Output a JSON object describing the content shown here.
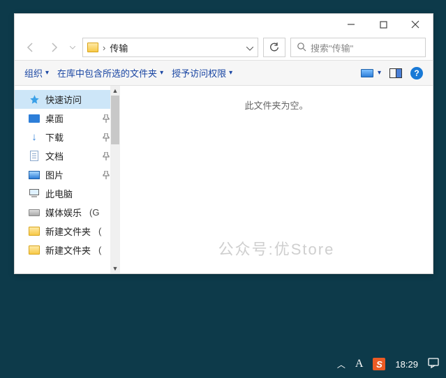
{
  "window": {
    "path": "传输",
    "search_placeholder": "搜索\"传输\""
  },
  "toolbar": {
    "organize": "组织",
    "include": "在库中包含所选的文件夹",
    "grant": "授予访问权限",
    "help": "?"
  },
  "sidebar": {
    "items": [
      {
        "label": "快速访问"
      },
      {
        "label": "桌面"
      },
      {
        "label": "下载"
      },
      {
        "label": "文档"
      },
      {
        "label": "图片"
      },
      {
        "label": "此电脑"
      },
      {
        "label": "媒体娱乐",
        "suffix": "(G"
      },
      {
        "label": "新建文件夹",
        "suffix": "("
      },
      {
        "label": "新建文件夹",
        "suffix": "("
      }
    ]
  },
  "content": {
    "empty": "此文件夹为空。"
  },
  "watermark": "公众号:优Store",
  "taskbar": {
    "input_indicator": "A",
    "ime": "S",
    "clock": "18:29"
  }
}
